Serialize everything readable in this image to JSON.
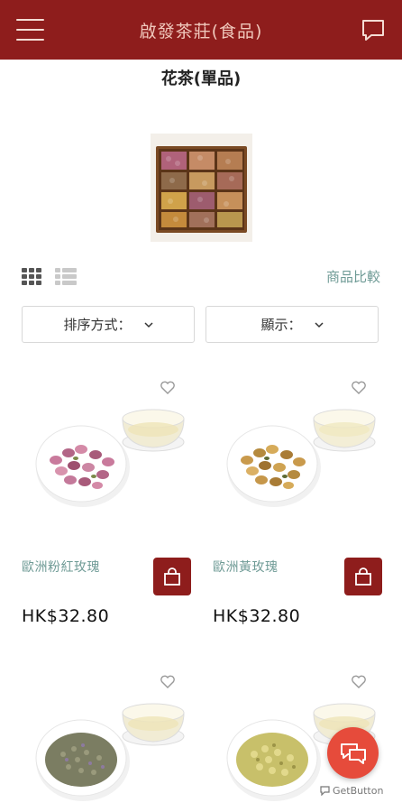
{
  "header": {
    "title": "啟發茶莊(食品)",
    "menu_icon": "hamburger-menu-icon",
    "chat_icon": "chat-bubble-icon",
    "background_color": "#8e1d1c"
  },
  "category": {
    "title": "花茶(單品)",
    "image": "wooden-tray-of-flower-teas"
  },
  "toolbar": {
    "grid_icon": "grid-view-icon",
    "list_icon": "list-view-icon",
    "compare_label": "商品比較"
  },
  "filters": {
    "sort_label": "排序方式：",
    "display_label": "顯示："
  },
  "products": [
    {
      "name": "歐洲粉紅玫瑰",
      "price": "HK$32.80",
      "image": "pink-rose-buds-with-tea-cup"
    },
    {
      "name": "歐洲黃玫瑰",
      "price": "HK$32.80",
      "image": "yellow-rose-buds-with-tea-cup"
    },
    {
      "name": "",
      "price": "",
      "image": "lavender-with-tea-cup"
    },
    {
      "name": "",
      "price": "",
      "image": "chamomile-with-tea-cup"
    }
  ],
  "floating": {
    "chat_icon": "chat-bubbles-icon",
    "powered_by": "GetButton",
    "accent_color": "#e64b3b"
  }
}
